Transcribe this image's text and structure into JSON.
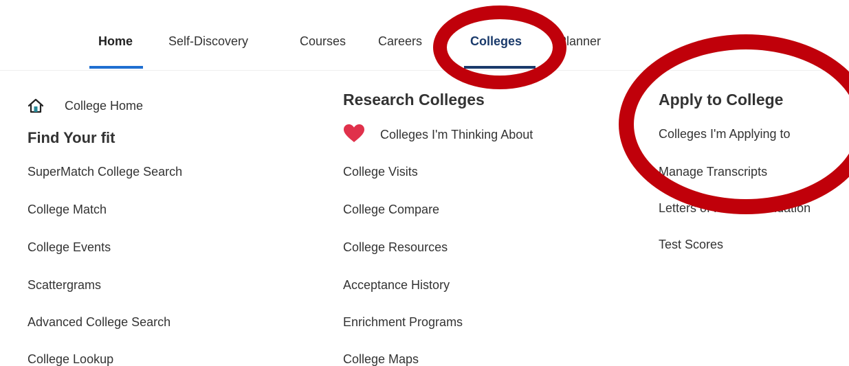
{
  "nav": {
    "tabs": [
      {
        "label": "Home",
        "state": "active"
      },
      {
        "label": "Self-Discovery"
      },
      {
        "label": "Courses"
      },
      {
        "label": "Careers"
      },
      {
        "label": "Colleges",
        "state": "active"
      },
      {
        "label": "Planner"
      }
    ]
  },
  "columns": {
    "left": {
      "college_home": "College Home",
      "heading": "Find Your fit",
      "links": [
        "SuperMatch College Search",
        "College Match",
        "College Events",
        "Scattergrams",
        "Advanced College Search",
        "College Lookup"
      ]
    },
    "middle": {
      "heading": "Research Colleges",
      "favorite": "Colleges I'm Thinking About",
      "links": [
        "College Visits",
        "College Compare",
        "College Resources",
        "Acceptance History",
        "Enrichment Programs",
        "College Maps"
      ]
    },
    "right": {
      "heading": "Apply to College",
      "links": [
        "Colleges I'm Applying to",
        "Manage Transcripts",
        "Letters of Recommendation",
        "Test Scores"
      ]
    }
  },
  "colors": {
    "accent_blue": "#1f6fd1",
    "active_navy": "#1a3a6b",
    "annotation_red": "#c0000a",
    "heart_red": "#e0314b",
    "home_icon_teal": "#2a8a9a"
  },
  "icons": {
    "home": "house-icon",
    "favorite": "heart-icon"
  }
}
